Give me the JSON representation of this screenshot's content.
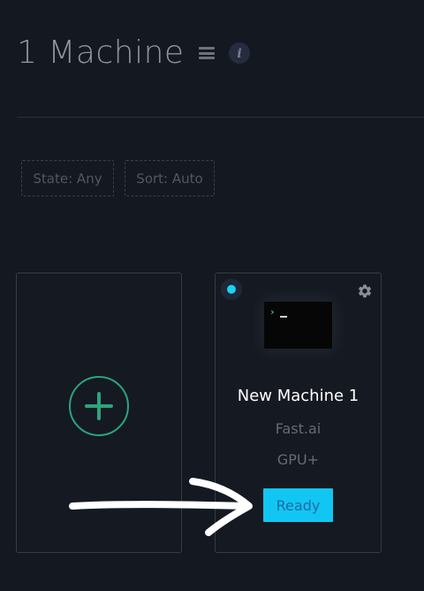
{
  "header": {
    "title": "1 Machine",
    "list_icon": "list-icon",
    "info_icon": "info-icon",
    "info_glyph": "i"
  },
  "filters": {
    "state_label": "State: Any",
    "sort_label": "Sort: Auto"
  },
  "add_card": {
    "icon": "plus-circle-icon",
    "accent_color": "#2ba57c"
  },
  "machine_card": {
    "name": "New Machine 1",
    "template": "Fast.ai",
    "tier": "GPU+",
    "status_button": "Ready",
    "status_color": "#12c6f3",
    "status_icon": "status-dot-icon",
    "settings_icon": "gear-icon",
    "terminal_icon": "terminal-icon",
    "terminal_prompt": "›"
  },
  "colors": {
    "background": "#141820",
    "annotation_arrow": "#ffffff"
  }
}
